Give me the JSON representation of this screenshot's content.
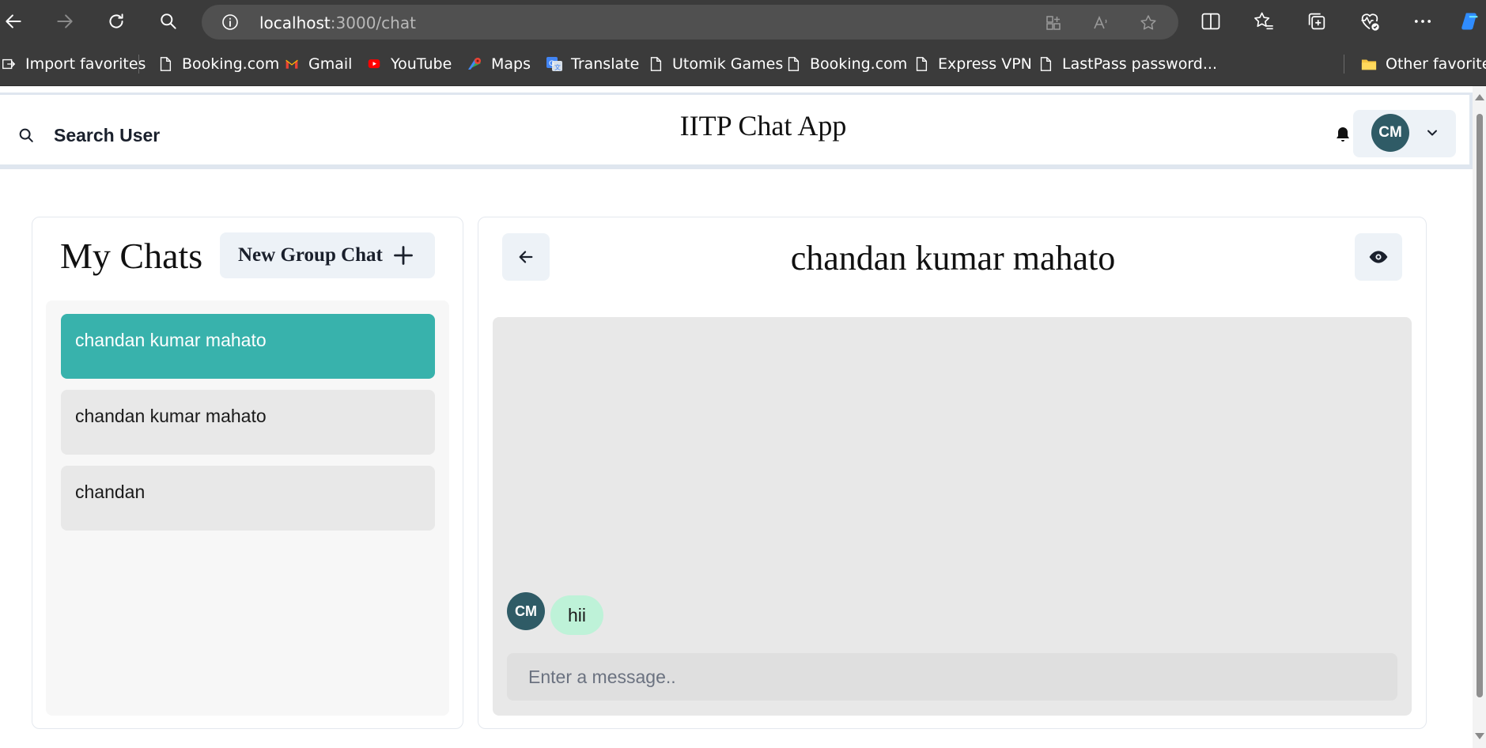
{
  "browser": {
    "url_host": "localhost",
    "url_path": ":3000/chat",
    "bookmarks": [
      {
        "label": "Import favorites",
        "icon": "import-icon"
      },
      {
        "label": "Booking.com",
        "icon": "page-icon"
      },
      {
        "label": "Gmail",
        "icon": "gmail-icon"
      },
      {
        "label": "YouTube",
        "icon": "youtube-icon"
      },
      {
        "label": "Maps",
        "icon": "maps-icon"
      },
      {
        "label": "Translate",
        "icon": "translate-icon"
      },
      {
        "label": "Utomik Games",
        "icon": "page-icon"
      },
      {
        "label": "Booking.com",
        "icon": "page-icon"
      },
      {
        "label": "Express VPN",
        "icon": "page-icon"
      },
      {
        "label": "LastPass password...",
        "icon": "page-icon"
      }
    ],
    "other_favorites": "Other favorites"
  },
  "header": {
    "search_label": "Search User",
    "app_title": "IITP Chat App",
    "user_initials": "CM"
  },
  "sidebar": {
    "title": "My Chats",
    "new_group_label": "New Group Chat",
    "chats": [
      {
        "name": "chandan kumar mahato",
        "active": true
      },
      {
        "name": "chandan kumar mahato",
        "active": false
      },
      {
        "name": "chandan",
        "active": false
      }
    ]
  },
  "chat": {
    "title": "chandan kumar mahato",
    "messages": [
      {
        "sender_initials": "CM",
        "text": "hii"
      }
    ],
    "input_placeholder": "Enter a message.."
  },
  "colors": {
    "active_chat": "#38b2ac",
    "bubble": "#bef2d8",
    "avatar": "#2f5b66"
  }
}
